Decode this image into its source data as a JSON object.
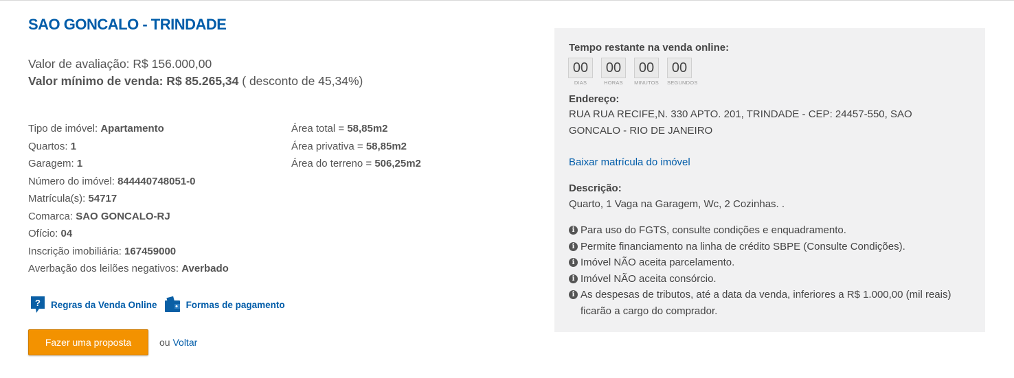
{
  "property": {
    "title": "SAO GONCALO - TRINDADE",
    "valor_avaliacao": "Valor de avaliação: R$ 156.000,00",
    "valor_minimo_label": "Valor mínimo de venda: R$ 85.265,34",
    "desconto": " ( desconto de 45,34%)"
  },
  "details_left": [
    {
      "label": "Tipo de imóvel: ",
      "value": "Apartamento"
    },
    {
      "label": "Quartos: ",
      "value": "1"
    },
    {
      "label": "Garagem: ",
      "value": "1"
    },
    {
      "label": "Número do imóvel: ",
      "value": "844440748051-0"
    },
    {
      "label": "Matrícula(s): ",
      "value": "54717"
    },
    {
      "label": "Comarca: ",
      "value": "SAO GONCALO-RJ"
    },
    {
      "label": "Ofício: ",
      "value": "04"
    },
    {
      "label": "Inscrição imobiliária: ",
      "value": "167459000"
    },
    {
      "label": "Averbação dos leilões negativos: ",
      "value": "Averbado"
    }
  ],
  "details_right": [
    {
      "label": "Área total = ",
      "value": "58,85m2"
    },
    {
      "label": "Área privativa = ",
      "value": "58,85m2"
    },
    {
      "label": "Área do terreno = ",
      "value": "506,25m2"
    }
  ],
  "links": {
    "regras": "Regras da Venda Online",
    "formas": "Formas de pagamento"
  },
  "actions": {
    "proposta": "Fazer uma proposta",
    "ou": "ou ",
    "voltar": "Voltar"
  },
  "panel": {
    "tempo_label": "Tempo restante na venda online:",
    "timer": [
      {
        "value": "00",
        "unit": "DIAS"
      },
      {
        "value": "00",
        "unit": "HORAS"
      },
      {
        "value": "00",
        "unit": "MINUTOS"
      },
      {
        "value": "00",
        "unit": "SEGUNDOS"
      }
    ],
    "endereco_label": "Endereço:",
    "endereco_line1": "RUA RUA RECIFE,N. 330 APTO. 201, TRINDADE - CEP: 24457-550, SAO",
    "endereco_line2": "GONCALO - RIO DE JANEIRO",
    "baixar": "Baixar matrícula do imóvel",
    "descricao_label": "Descrição:",
    "descricao": "Quarto, 1 Vaga na Garagem, Wc, 2 Cozinhas. .",
    "info": [
      "Para uso do FGTS, consulte condições e enquadramento.",
      "Permite financiamento na linha de crédito SBPE (Consulte Condições).",
      "Imóvel NÃO aceita parcelamento.",
      "Imóvel NÃO aceita consórcio.",
      "As despesas de tributos, até a data da venda, inferiores a R$ 1.000,00 (mil reais) ficarão a cargo do comprador."
    ]
  },
  "colors": {
    "brand_blue": "#005ca9",
    "button_orange": "#f39200",
    "panel_bg": "#f1f1f2"
  },
  "icons": [
    "question-icon",
    "wallet-icon",
    "info-icon"
  ]
}
